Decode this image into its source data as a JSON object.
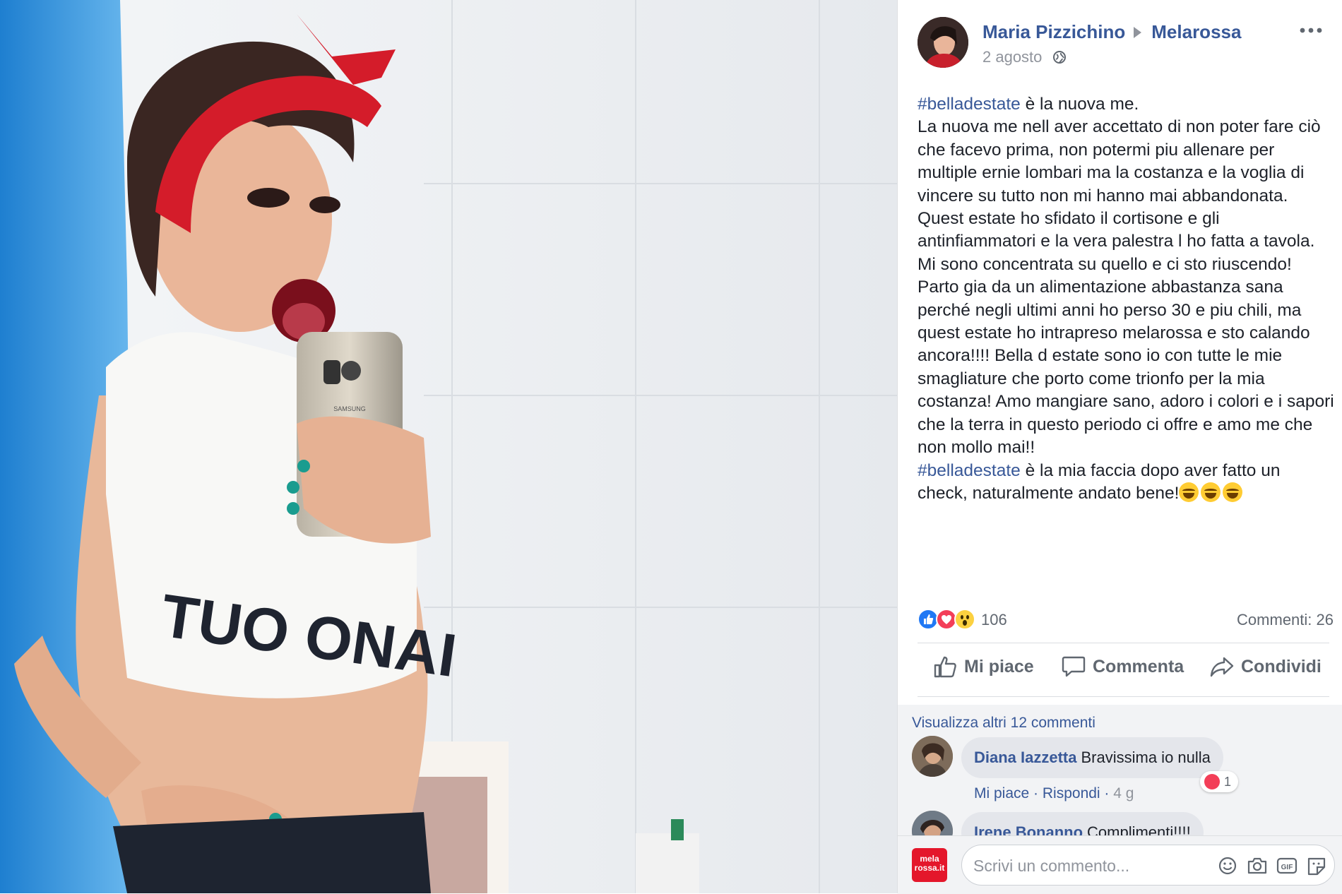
{
  "post": {
    "author": "Maria Pizzichino",
    "page": "Melarossa",
    "date": "2 agosto",
    "hashtag": "#belladestate",
    "paragraphs": [
      " è la nuova me.",
      "La nuova me nell aver accettato di non poter fare ciò che facevo prima, non potermi piu allenare per multiple ernie lombari ma la costanza e la voglia di vincere su tutto non mi hanno mai abbandonata. Quest estate ho sfidato il cortisone e gli antinfiammatori e la vera palestra l ho fatta a tavola. Mi sono concentrata su quello e ci sto riuscendo! Parto gia da un alimentazione abbastanza sana perché negli ultimi anni ho perso 30 e piu chili, ma quest estate ho intrapreso melarossa e sto calando ancora!!!! Bella d estate sono io con tutte le mie smagliature che porto come trionfo per la mia costanza! Amo mangiare sano, adoro i colori e i sapori che la terra in questo periodo ci offre e amo me che non mollo mai!!"
    ],
    "last_line": " è la mia faccia dopo aver fatto un check, naturalmente andato bene!",
    "reaction_count": "106",
    "comments_label": "Commenti: 26"
  },
  "photo": {
    "shirt_text": "TUO ONAI",
    "phone_brand": "SAMSUNG"
  },
  "actions": {
    "like": "Mi piace",
    "comment": "Commenta",
    "share": "Condividi"
  },
  "comments": {
    "view_more": "Visualizza altri 12 commenti",
    "items": [
      {
        "author": "Diana Iazzetta",
        "text": "Bravissima io nulla",
        "like": "Mi piace",
        "reply": "Rispondi",
        "time": "4 g",
        "reactions": "1"
      },
      {
        "author": "Irene Bonanno",
        "text": "Complimenti!!!!"
      }
    ]
  },
  "composer": {
    "placeholder": "Scrivi un commento...",
    "logo_text": "mela rossa.it"
  },
  "colors": {
    "link": "#385898",
    "muted": "#90949c",
    "like_blue": "#2078f4",
    "love_red": "#f33e58",
    "wow_yellow": "#fcd140",
    "brand_red": "#e4172b"
  }
}
